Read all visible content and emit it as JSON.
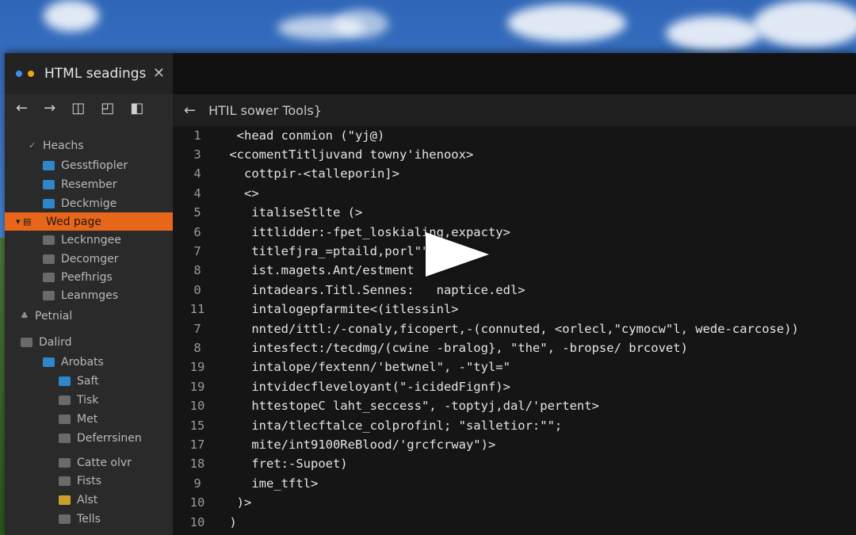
{
  "tab": {
    "title": "HTML seadings",
    "close": "✕"
  },
  "toolbar": {
    "back": "←",
    "forward": "→",
    "b1": "◫",
    "b2": "◰",
    "b3": "◧"
  },
  "sidebar": {
    "items": [
      {
        "label": "Heachs",
        "icon": "check",
        "indent": 30
      },
      {
        "label": "Gesstfiopler",
        "icon": "folder-blue",
        "indent": 48
      },
      {
        "label": "Resember",
        "icon": "folder-blue",
        "indent": 48
      },
      {
        "label": "Deckmige",
        "icon": "folder-blue",
        "indent": 48
      },
      {
        "label": "Wed page",
        "icon": "file-orange",
        "indent": 14,
        "selected": true
      },
      {
        "label": "Lecknngee",
        "icon": "folder-gray",
        "indent": 48
      },
      {
        "label": "Decomger",
        "icon": "folder-gray",
        "indent": 48
      },
      {
        "label": "Peefhrigs",
        "icon": "folder-gray",
        "indent": 48
      },
      {
        "label": "Leanmges",
        "icon": "folder-gray",
        "indent": 48
      },
      {
        "label": "Petnial",
        "icon": "leaf",
        "indent": 20
      },
      {
        "label": "Dalird",
        "icon": "folder-gray",
        "indent": 20
      },
      {
        "label": "Arobats",
        "icon": "folder-blue",
        "indent": 48
      },
      {
        "label": "Saft",
        "icon": "folder-blue",
        "indent": 68
      },
      {
        "label": "Tisk",
        "icon": "folder-gray",
        "indent": 68
      },
      {
        "label": "Met",
        "icon": "folder-gray",
        "indent": 68
      },
      {
        "label": "Deferrsinen",
        "icon": "folder-gray",
        "indent": 68
      },
      {
        "label": "Catte olvr",
        "icon": "folder-gray",
        "indent": 68
      },
      {
        "label": "Fists",
        "icon": "folder-gray",
        "indent": 68
      },
      {
        "label": "Alst",
        "icon": "folder-yellow",
        "indent": 68
      },
      {
        "label": "Tells",
        "icon": "folder-gray",
        "indent": 68
      }
    ]
  },
  "editor": {
    "back": "←",
    "title": "HTIL sower Tools}",
    "lines": [
      {
        "n": "1",
        "text": "  <head conmion (\"yj@)"
      },
      {
        "n": "3",
        "text": " <ccomentTitljuvand towny'ihenoox>"
      },
      {
        "n": "4",
        "text": "   cottpir-<talleporin]>"
      },
      {
        "n": "4",
        "text": "   <>"
      },
      {
        "n": "5",
        "text": "    italiseStlte (>"
      },
      {
        "n": "6",
        "text": "    ittlidder:-fpet_loskialing,expacty>"
      },
      {
        "n": "7",
        "text": "    titlefjra_=ptaild,porl\"\""
      },
      {
        "n": "8",
        "text": "    ist.magets.Ant/estment"
      },
      {
        "n": "0",
        "text": "    intadears.Titl.Sennes:   naptice.edl>"
      },
      {
        "n": "11",
        "text": "    intalogepfarmite<(itlessinl>"
      },
      {
        "n": "7",
        "text": "    nnted/ittl:/-conaly,ficopert,-(connuted, <orlecl,\"cymocw\"l, wede-carcose))"
      },
      {
        "n": "8",
        "text": "    intesfect:/tecdmg/(cwine -bralog}, \"the\", -bropse/ brcovet)"
      },
      {
        "n": "19",
        "text": "    intalope/fextenn/'betwnel\", -\"tyl=\""
      },
      {
        "n": "19",
        "text": "    intvidecflevelоyant(\"-icidedFignf)>"
      },
      {
        "n": "10",
        "text": "    httestopeC laht_seccess\", -toptyj,dal/'pertent>"
      },
      {
        "n": "15",
        "text": "    inta/tlecftalce_colprofinl; \"salletior:\"\";"
      },
      {
        "n": "17",
        "text": "    mite/int9100ReBlood/'grcfcrway\")>"
      },
      {
        "n": "18",
        "text": "    fret:-Supoet)"
      },
      {
        "n": "9",
        "text": "    ime_tftl>"
      },
      {
        "n": "10",
        "text": "  )>"
      },
      {
        "n": "10",
        "text": " )"
      }
    ]
  },
  "colors": {
    "accent": "#e8661a",
    "bg": "#151515",
    "sidebar": "#2a2a2a"
  }
}
